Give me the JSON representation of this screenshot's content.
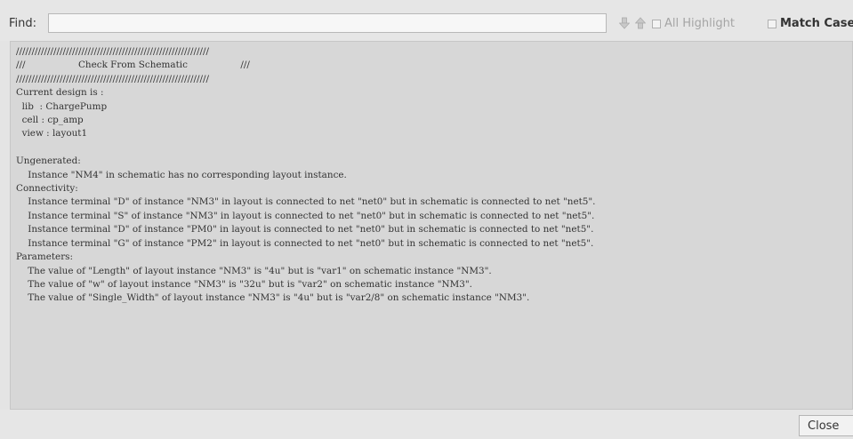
{
  "find": {
    "label": "Find:",
    "value": "",
    "placeholder": "",
    "next_icon": "arrow-down-icon",
    "prev_icon": "arrow-up-icon",
    "all_highlight_label": "All Highlight",
    "all_highlight_checked": false,
    "match_case_label": "Match Case",
    "match_case_checked": false
  },
  "report": {
    "lines": [
      "//////////////////////////////////////////////////////////////",
      "///                  Check From Schematic                  ///",
      "//////////////////////////////////////////////////////////////",
      "Current design is :",
      "  lib  : ChargePump",
      "  cell : cp_amp",
      "  view : layout1",
      "",
      "Ungenerated:",
      "    Instance \"NM4\" in schematic has no corresponding layout instance.",
      "Connectivity:",
      "    Instance terminal \"D\" of instance \"NM3\" in layout is connected to net \"net0\" but in schematic is connected to net \"net5\".",
      "    Instance terminal \"S\" of instance \"NM3\" in layout is connected to net \"net0\" but in schematic is connected to net \"net5\".",
      "    Instance terminal \"D\" of instance \"PM0\" in layout is connected to net \"net0\" but in schematic is connected to net \"net5\".",
      "    Instance terminal \"G\" of instance \"PM2\" in layout is connected to net \"net0\" but in schematic is connected to net \"net5\".",
      "Parameters:",
      "    The value of \"Length\" of layout instance \"NM3\" is \"4u\" but is \"var1\" on schematic instance \"NM3\".",
      "    The value of \"w\" of layout instance \"NM3\" is \"32u\" but is \"var2\" on schematic instance \"NM3\".",
      "    The value of \"Single_Width\" of layout instance \"NM3\" is \"4u\" but is \"var2/8\" on schematic instance \"NM3\"."
    ]
  },
  "footer": {
    "close_label": "Close"
  }
}
